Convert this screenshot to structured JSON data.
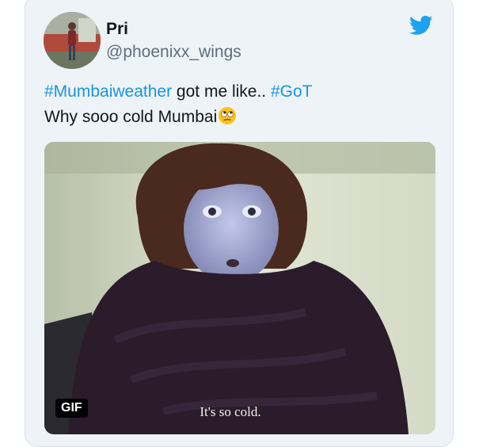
{
  "user": {
    "name": "Pri",
    "handle": "@phoenixx_wings"
  },
  "tweet": {
    "hashtag1": "#Mumbaiweather",
    "text1": " got me like.. ",
    "hashtag2": "#GoT",
    "line2": "Why sooo cold Mumbai",
    "emoji": "rolling-eyes-emoji"
  },
  "media": {
    "badge": "GIF",
    "caption": "It's so cold."
  },
  "icons": {
    "brand": "twitter-bird-icon"
  },
  "colors": {
    "hashtag": "#1b95e0",
    "brand": "#1da1f2",
    "card_background": "#eef3f7"
  }
}
